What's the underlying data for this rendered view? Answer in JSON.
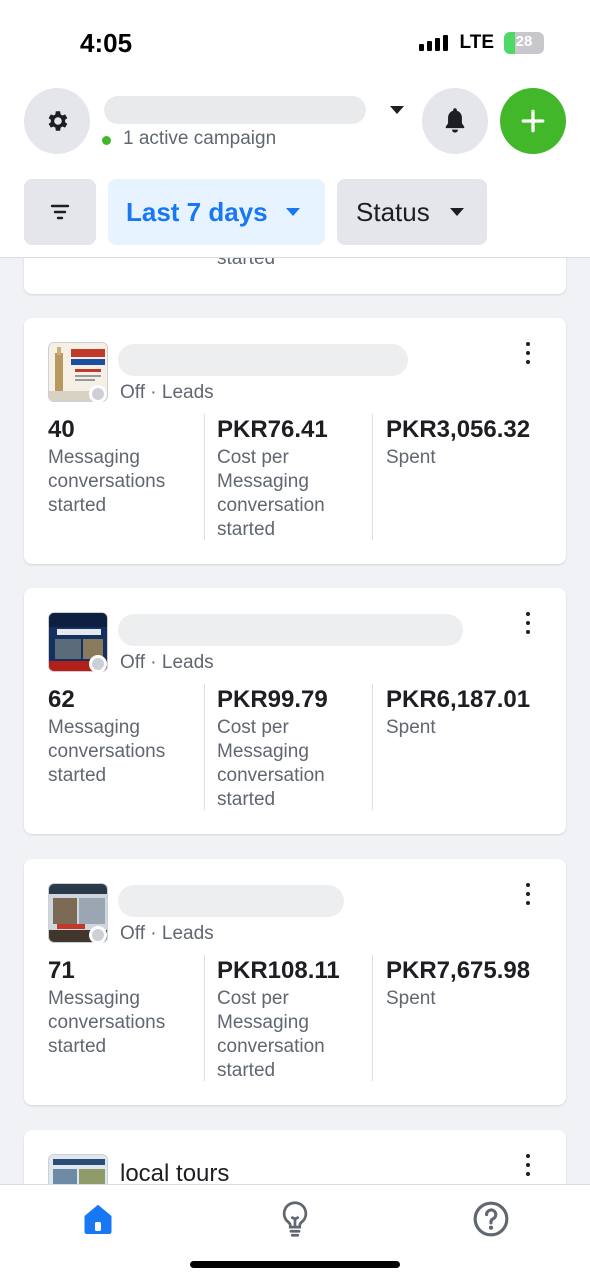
{
  "status_bar": {
    "time": "4:05",
    "network": "LTE",
    "battery": "28",
    "battery_level": 0.28
  },
  "header": {
    "account_subtitle": "1 active campaign",
    "filters": {
      "date_range": "Last 7 days",
      "status": "Status"
    }
  },
  "icons": {
    "settings": "gear-icon",
    "notifications": "bell-icon",
    "create": "plus-icon",
    "filter": "filter-icon",
    "home": "home-icon",
    "tips": "lightbulb-icon",
    "help": "question-icon"
  },
  "top_partial": {
    "label_tail": "started"
  },
  "campaigns": [
    {
      "status": "Off",
      "objective": "Leads",
      "results_value": "40",
      "results_label": "Messaging conversations started",
      "cost_value": "PKR76.41",
      "cost_label": "Cost per Messaging conversation started",
      "spent_value": "PKR3,056.32",
      "spent_label": "Spent"
    },
    {
      "status": "Off",
      "objective": "Leads",
      "results_value": "62",
      "results_label": "Messaging conversations started",
      "cost_value": "PKR99.79",
      "cost_label": "Cost per Messaging conversation started",
      "spent_value": "PKR6,187.01",
      "spent_label": "Spent"
    },
    {
      "status": "Off",
      "objective": "Leads",
      "results_value": "71",
      "results_label": "Messaging conversations started",
      "cost_value": "PKR108.11",
      "cost_label": "Cost per Messaging conversation started",
      "spent_value": "PKR7,675.98",
      "spent_label": "Spent"
    }
  ],
  "bottom_partial": {
    "name": "local tours"
  },
  "colors": {
    "accent": "#1877f2",
    "create": "#42b72a",
    "background": "#f0f2f5"
  }
}
